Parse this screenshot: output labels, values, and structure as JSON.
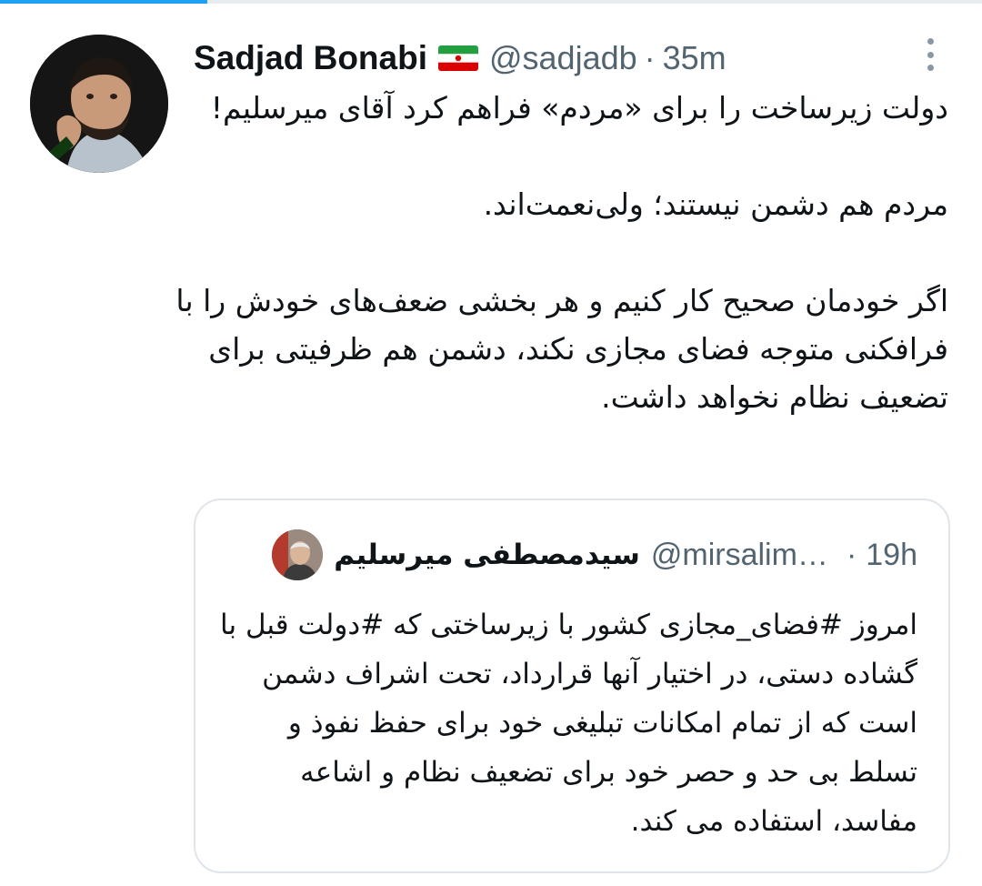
{
  "tweet": {
    "display_name": "Sadjad Bonabi",
    "flag_icon": "iran-flag-icon",
    "handle": "@sadjadb",
    "separator": "·",
    "time": "35m",
    "paragraphs": [
      "دولت زیرساخت را برای «مردم» فراهم کرد آقای میرسلیم!",
      "مردم هم دشمن نیستند؛ ولی‌نعمت‌اند.",
      "اگر خودمان صحیح کار کنیم و هر بخشی ضعف‌های خودش را با فرافکنی متوجه فضای مجازی نکند، دشمن هم ظرفیتی برای تضعیف نظام نخواهد داشت."
    ]
  },
  "quoted_tweet": {
    "display_name": "سیدمصطفی میرسلیم",
    "handle": "@mirsalim…",
    "separator": "·",
    "time": "19h",
    "text": "امروز #فضای_مجازی کشور با زیرساختی که #دولت قبل با گشاده دستی، در اختیار آنها قرارداد، تحت اشراف دشمن است که از تمام امکانات تبلیغی خود برای حفظ نفوذ و تسلط بی حد و حصر خود برای تضعیف نظام و اشاعه مفاسد، استفاده می کند."
  },
  "colors": {
    "muted_text": "#536471",
    "card_border": "#dfe5ea",
    "accent": "#1da1f2"
  }
}
